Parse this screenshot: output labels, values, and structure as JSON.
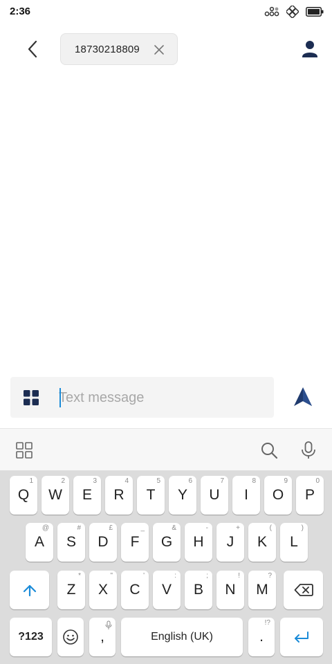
{
  "status_bar": {
    "time": "2:36"
  },
  "header": {
    "recipient": "18730218809"
  },
  "compose": {
    "placeholder": "Text message"
  },
  "keyboard": {
    "row1": [
      {
        "label": "Q",
        "hint": "1"
      },
      {
        "label": "W",
        "hint": "2"
      },
      {
        "label": "E",
        "hint": "3"
      },
      {
        "label": "R",
        "hint": "4"
      },
      {
        "label": "T",
        "hint": "5"
      },
      {
        "label": "Y",
        "hint": "6"
      },
      {
        "label": "U",
        "hint": "7"
      },
      {
        "label": "I",
        "hint": "8"
      },
      {
        "label": "O",
        "hint": "9"
      },
      {
        "label": "P",
        "hint": "0"
      }
    ],
    "row2": [
      {
        "label": "A",
        "hint": "@"
      },
      {
        "label": "S",
        "hint": "#"
      },
      {
        "label": "D",
        "hint": "£"
      },
      {
        "label": "F",
        "hint": "_"
      },
      {
        "label": "G",
        "hint": "&"
      },
      {
        "label": "H",
        "hint": "-"
      },
      {
        "label": "J",
        "hint": "+"
      },
      {
        "label": "K",
        "hint": "("
      },
      {
        "label": "L",
        "hint": ")"
      }
    ],
    "row3": [
      {
        "label": "Z",
        "hint": "*"
      },
      {
        "label": "X",
        "hint": "\""
      },
      {
        "label": "C",
        "hint": "'"
      },
      {
        "label": "V",
        "hint": ":"
      },
      {
        "label": "B",
        "hint": ";"
      },
      {
        "label": "N",
        "hint": "!"
      },
      {
        "label": "M",
        "hint": "?"
      }
    ],
    "symbols_label": "?123",
    "comma_label": ",",
    "space_label": "English (UK)",
    "period_label": ".",
    "period_hint": "!?"
  },
  "colors": {
    "accent": "#1a8bd8",
    "send": "#1f3a6e"
  }
}
